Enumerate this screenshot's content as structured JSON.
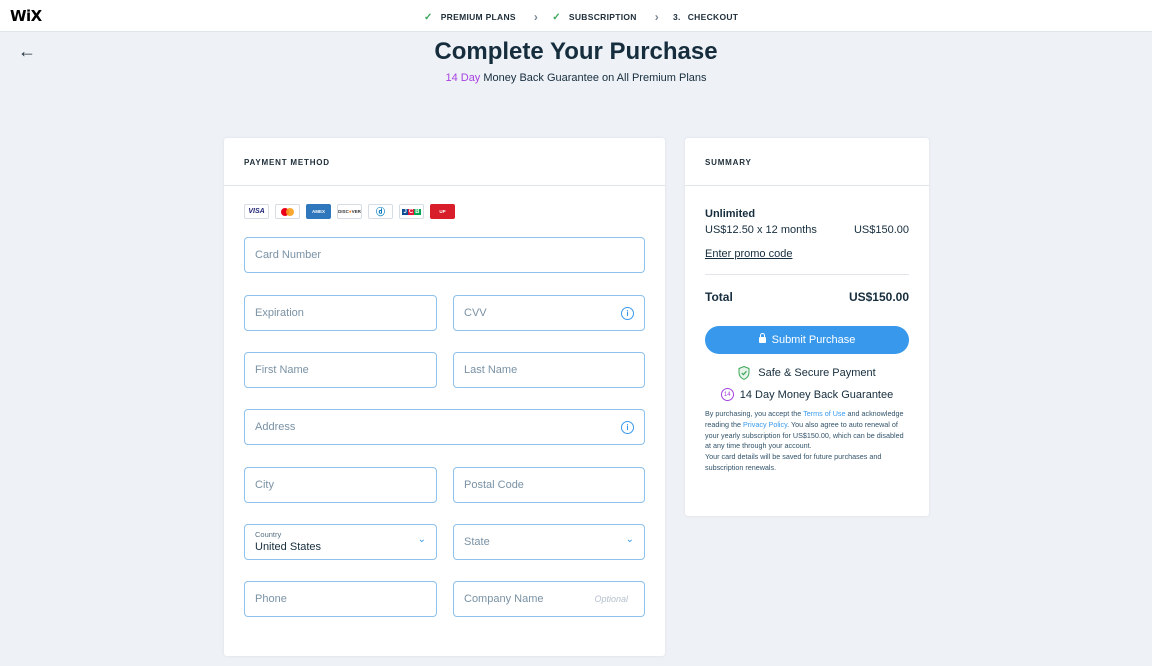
{
  "brand": "WiX",
  "steps": [
    {
      "label": "PREMIUM PLANS",
      "done": true
    },
    {
      "label": "SUBSCRIPTION",
      "done": true
    },
    {
      "label": "CHECKOUT",
      "number": "3."
    }
  ],
  "header": {
    "title": "Complete Your Purchase",
    "guarantee_highlight": "14 Day",
    "guarantee_rest": "Money Back Guarantee on All Premium Plans"
  },
  "payment": {
    "heading": "PAYMENT METHOD",
    "card_logos": [
      "VISA",
      "Mastercard",
      "AMERICAN EXPRESS",
      "DISCOVER",
      "Diners Club",
      "JCB",
      "UnionPay"
    ],
    "fields": {
      "card_number": "Card Number",
      "expiration": "Expiration",
      "cvv": "CVV",
      "first_name": "First Name",
      "last_name": "Last Name",
      "address": "Address",
      "city": "City",
      "postal_code": "Postal Code",
      "country_label": "Country",
      "country_value": "United States",
      "state": "State",
      "phone": "Phone",
      "company": "Company Name",
      "company_optional": "Optional"
    }
  },
  "summary": {
    "heading": "SUMMARY",
    "plan_name": "Unlimited",
    "plan_price_detail": "US$12.50 x 12 months",
    "plan_price": "US$150.00",
    "promo_link": "Enter promo code",
    "total_label": "Total",
    "total_value": "US$150.00",
    "submit_label": "Submit Purchase",
    "secure_label": "Safe & Secure Payment",
    "moneyback_label": "14 Day Money Back Guarantee",
    "moneyback_badge": "14",
    "legal": {
      "part1": "By purchasing, you accept the ",
      "terms_link": "Terms of Use",
      "part2": " and acknowledge reading the ",
      "privacy_link": "Privacy Policy",
      "part3": ". You also agree to auto renewal of your yearly subscription for US$150.00, which can be disabled at any time through your account.",
      "part4": "Your card details will be saved for future purchases and subscription renewals."
    }
  },
  "colors": {
    "accent": "#3899ec",
    "purple": "#a642e0",
    "check": "#3da65a",
    "background": "#eef1f6"
  }
}
